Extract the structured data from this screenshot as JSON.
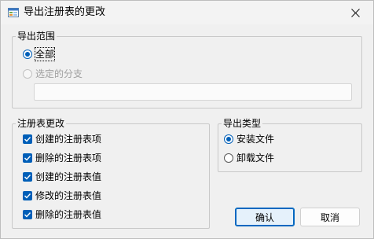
{
  "window": {
    "title": "导出注册表的更改",
    "close_glyph": "✕"
  },
  "export_range": {
    "legend": "导出范围",
    "options": [
      {
        "label": "全部",
        "selected": true,
        "enabled": true
      },
      {
        "label": "选定的分支",
        "selected": false,
        "enabled": false
      }
    ],
    "branch_value": ""
  },
  "registry_changes": {
    "legend": "注册表更改",
    "items": [
      {
        "label": "创建的注册表项",
        "checked": true
      },
      {
        "label": "删除的注册表项",
        "checked": true
      },
      {
        "label": "创建的注册表值",
        "checked": true
      },
      {
        "label": "修改的注册表值",
        "checked": true
      },
      {
        "label": "删除的注册表值",
        "checked": true
      }
    ]
  },
  "export_type": {
    "legend": "导出类型",
    "options": [
      {
        "label": "安装文件",
        "selected": true
      },
      {
        "label": "卸载文件",
        "selected": false
      }
    ]
  },
  "buttons": {
    "ok": "确认",
    "cancel": "取消"
  },
  "colors": {
    "accent": "#005fb8",
    "background": "#f0f0f0"
  }
}
